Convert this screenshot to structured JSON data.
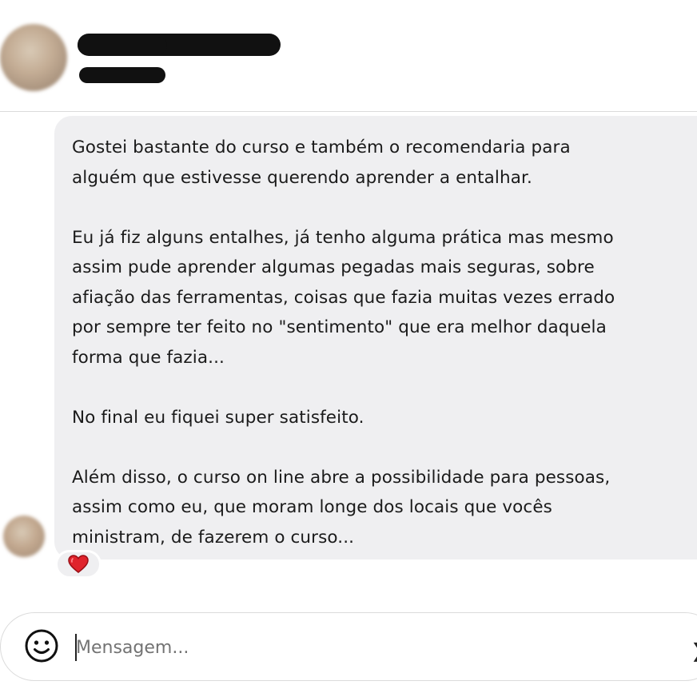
{
  "conversation": {
    "contact_name": "",
    "contact_status": ""
  },
  "message": {
    "text": "Gostei bastante do curso e também o recomendaria para\nalguém que estivesse querendo aprender a entalhar.\n\nEu já fiz alguns entalhes, já tenho alguma prática mas mesmo\nassim pude aprender algumas pegadas mais seguras, sobre\nafiação das ferramentas, coisas que fazia muitas vezes errado\npor sempre ter feito no \"sentimento\" que era melhor daquela\nforma que fazia...\n\nNo final eu fiquei super satisfeito.\n\nAlém disso, o curso on line abre a possibilidade para pessoas,\nassim como eu, que moram longe dos locais que vocês\nministram, de fazerem o curso...",
    "reaction": "heart-icon",
    "reaction_color": "#e0242c",
    "bubble_color": "#efeff1"
  },
  "composer": {
    "placeholder": "Mensagem...",
    "value": "",
    "emoji_icon": "smiley-icon"
  }
}
